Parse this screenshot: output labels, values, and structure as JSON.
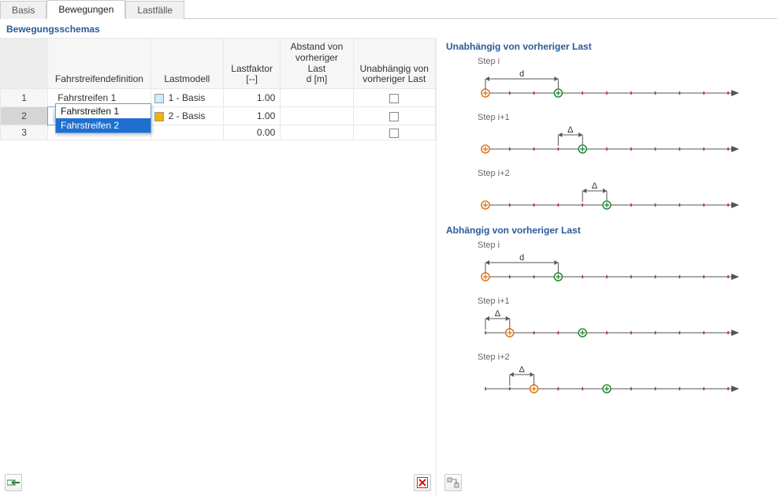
{
  "tabs": {
    "basis": "Basis",
    "movements": "Bewegungen",
    "loadcases": "Lastfälle",
    "active": "movements"
  },
  "panelTitle": "Bewegungsschemas",
  "grid": {
    "headers": {
      "lane": "Fahrstreifendefinition",
      "model": "Lastmodell",
      "factor": "Lastfaktor\n[--]",
      "dist": "Abstand von\nvorheriger Last\nd [m]",
      "indep": "Unabhängig von\nvorheriger Last"
    },
    "rows": [
      {
        "n": "1",
        "lane": "Fahrstreifen 1",
        "model": "1 - Basis",
        "swatch": "#cceffd",
        "factor": "1.00",
        "dist": "",
        "indep": false
      },
      {
        "n": "2",
        "lane": "Fahrstreifen 2",
        "model": "2 - Basis",
        "swatch": "#f2b200",
        "factor": "1.00",
        "dist": "",
        "indep": false,
        "editing": true
      },
      {
        "n": "3",
        "lane": "",
        "model": "",
        "swatch": null,
        "factor": "0.00",
        "dist": "",
        "indep": false
      }
    ]
  },
  "dropdown": {
    "options": [
      "Fahrstreifen 1",
      "Fahrstreifen 2"
    ],
    "selected": "Fahrstreifen 2"
  },
  "right": {
    "sectionA": "Unabhängig von vorheriger Last",
    "sectionB": "Abhängig von vorheriger Last",
    "steps": {
      "a": "Step i",
      "b": "Step i+1",
      "c": "Step i+2"
    },
    "dim_d": "d",
    "dim_delta": "Δ"
  },
  "icons": {
    "insert": "insert-row",
    "delete": "delete",
    "reorder": "reorder"
  }
}
